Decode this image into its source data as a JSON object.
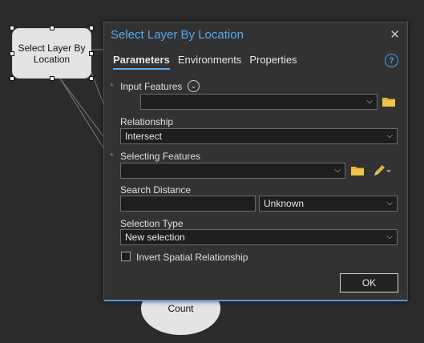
{
  "canvas": {
    "tool_node_label": "Select Layer By Location",
    "count_node_label": "Count"
  },
  "dialog": {
    "title": "Select Layer By Location",
    "close_glyph": "✕",
    "help_glyph": "?",
    "tabs": [
      {
        "label": "Parameters",
        "active": true
      },
      {
        "label": "Environments",
        "active": false
      },
      {
        "label": "Properties",
        "active": false
      }
    ],
    "input_features": {
      "label": "Input Features",
      "required_mark": "*",
      "value": ""
    },
    "relationship": {
      "label": "Relationship",
      "value": "Intersect"
    },
    "selecting_features": {
      "label": "Selecting Features",
      "required_mark": "*",
      "value": ""
    },
    "search_distance": {
      "label": "Search Distance",
      "value": "",
      "unit": "Unknown"
    },
    "selection_type": {
      "label": "Selection Type",
      "value": "New selection"
    },
    "invert": {
      "label": "Invert Spatial Relationship",
      "checked": false
    },
    "ok_label": "OK"
  },
  "colors": {
    "accent": "#5aa9ec",
    "required": "#d0583a",
    "folder": "#e5b53a"
  },
  "icons": [
    "expand-icon",
    "folder-icon",
    "pencil-icon",
    "close-icon",
    "help-icon",
    "chevron-down-icon"
  ]
}
